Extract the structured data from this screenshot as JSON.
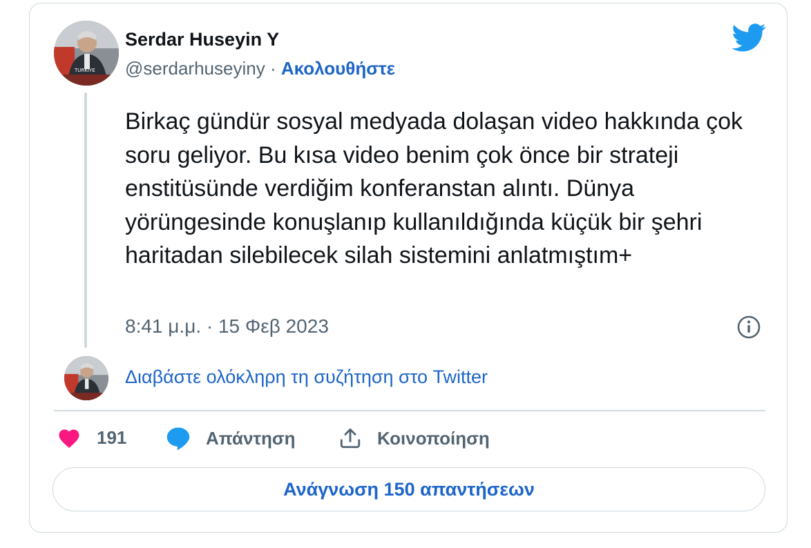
{
  "tweet": {
    "author_name": "Serdar Huseyin Y",
    "handle": "@serdarhuseyiny",
    "separator": " · ",
    "follow_label": "Ακολουθήστε",
    "text": "Birkaç gündür sosyal medyada dolaşan video hakkında çok soru geliyor. Bu kısa video benim çok önce bir strateji enstitüsünde verdiğim konferanstan alıntı. Dünya yörüngesinde konuşlanıp kullanıldığında küçük bir şehri haritadan silebilecek silah sistemini anlatmıştım+",
    "timestamp": "8:41 μ.μ. · 15 Φεβ 2023",
    "read_conversation_label": "Διαβάστε ολόκληρη τη συζήτηση στο Twitter",
    "avatar_caption": "TURKIYE"
  },
  "actions": {
    "like_count": "191",
    "reply_label": "Απάντηση",
    "share_label": "Κοινοποίηση"
  },
  "replies_button_label": "Ανάγνωση 150 απαντήσεων",
  "colors": {
    "accent": "#1d65c9",
    "twitter_blue": "#1d9bf0",
    "like_pink": "#f91880",
    "muted": "#536471",
    "border": "#cfd9de"
  },
  "icons": [
    "twitter-bird-icon",
    "info-icon",
    "heart-icon",
    "reply-bubble-icon",
    "share-icon"
  ]
}
